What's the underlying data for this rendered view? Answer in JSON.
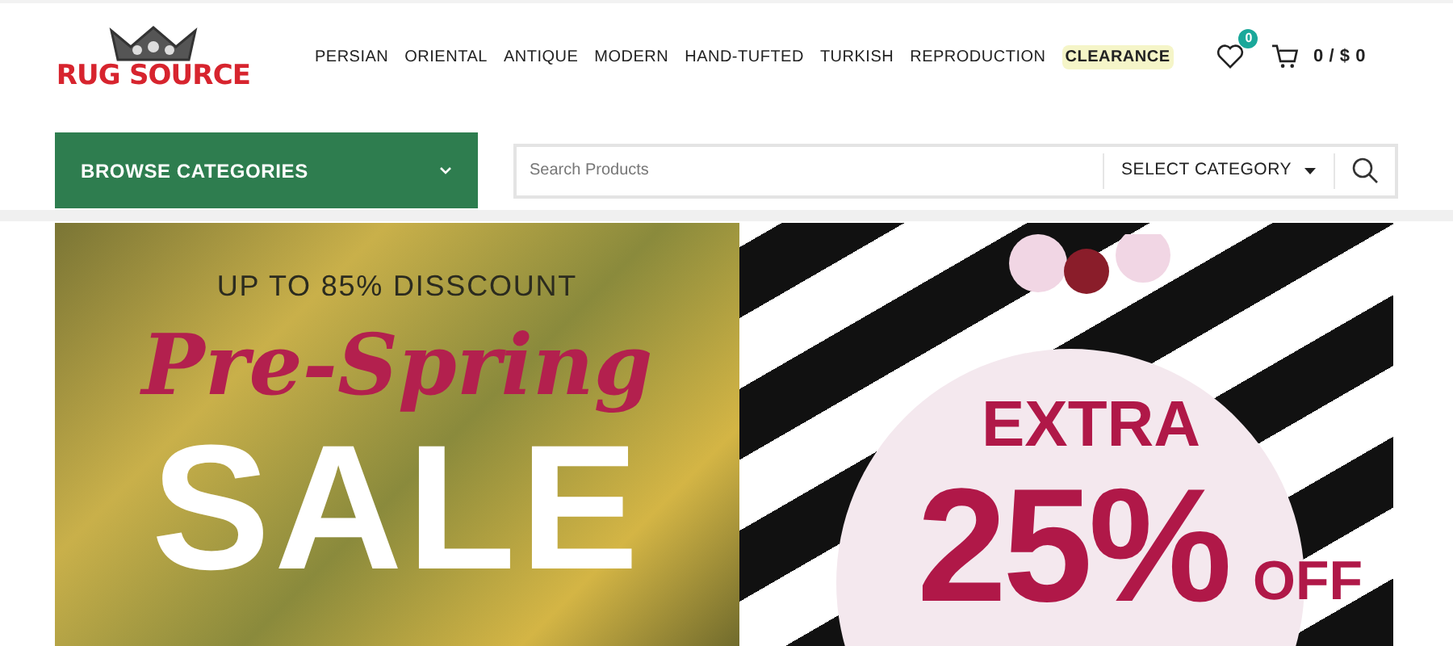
{
  "logo": {
    "text": "RUG SOURCE"
  },
  "nav": [
    {
      "label": "PERSIAN",
      "highlighted": false
    },
    {
      "label": "ORIENTAL",
      "highlighted": false
    },
    {
      "label": "ANTIQUE",
      "highlighted": false
    },
    {
      "label": "MODERN",
      "highlighted": false
    },
    {
      "label": "HAND-TUFTED",
      "highlighted": false
    },
    {
      "label": "TURKISH",
      "highlighted": false
    },
    {
      "label": "REPRODUCTION",
      "highlighted": false
    },
    {
      "label": "CLEARANCE",
      "highlighted": true
    }
  ],
  "wishlist": {
    "count": "0"
  },
  "cart": {
    "summary": "0 / $ 0"
  },
  "browse": {
    "label": "BROWSE CATEGORIES"
  },
  "search": {
    "placeholder": "Search Products",
    "category": "SELECT CATEGORY"
  },
  "banner": {
    "caption": "UP TO 85% DISSCOUNT",
    "script": "Pre-Spring",
    "headline": "SALE",
    "label": "EXTRA",
    "amount": "25%",
    "suffix": "OFF"
  }
}
